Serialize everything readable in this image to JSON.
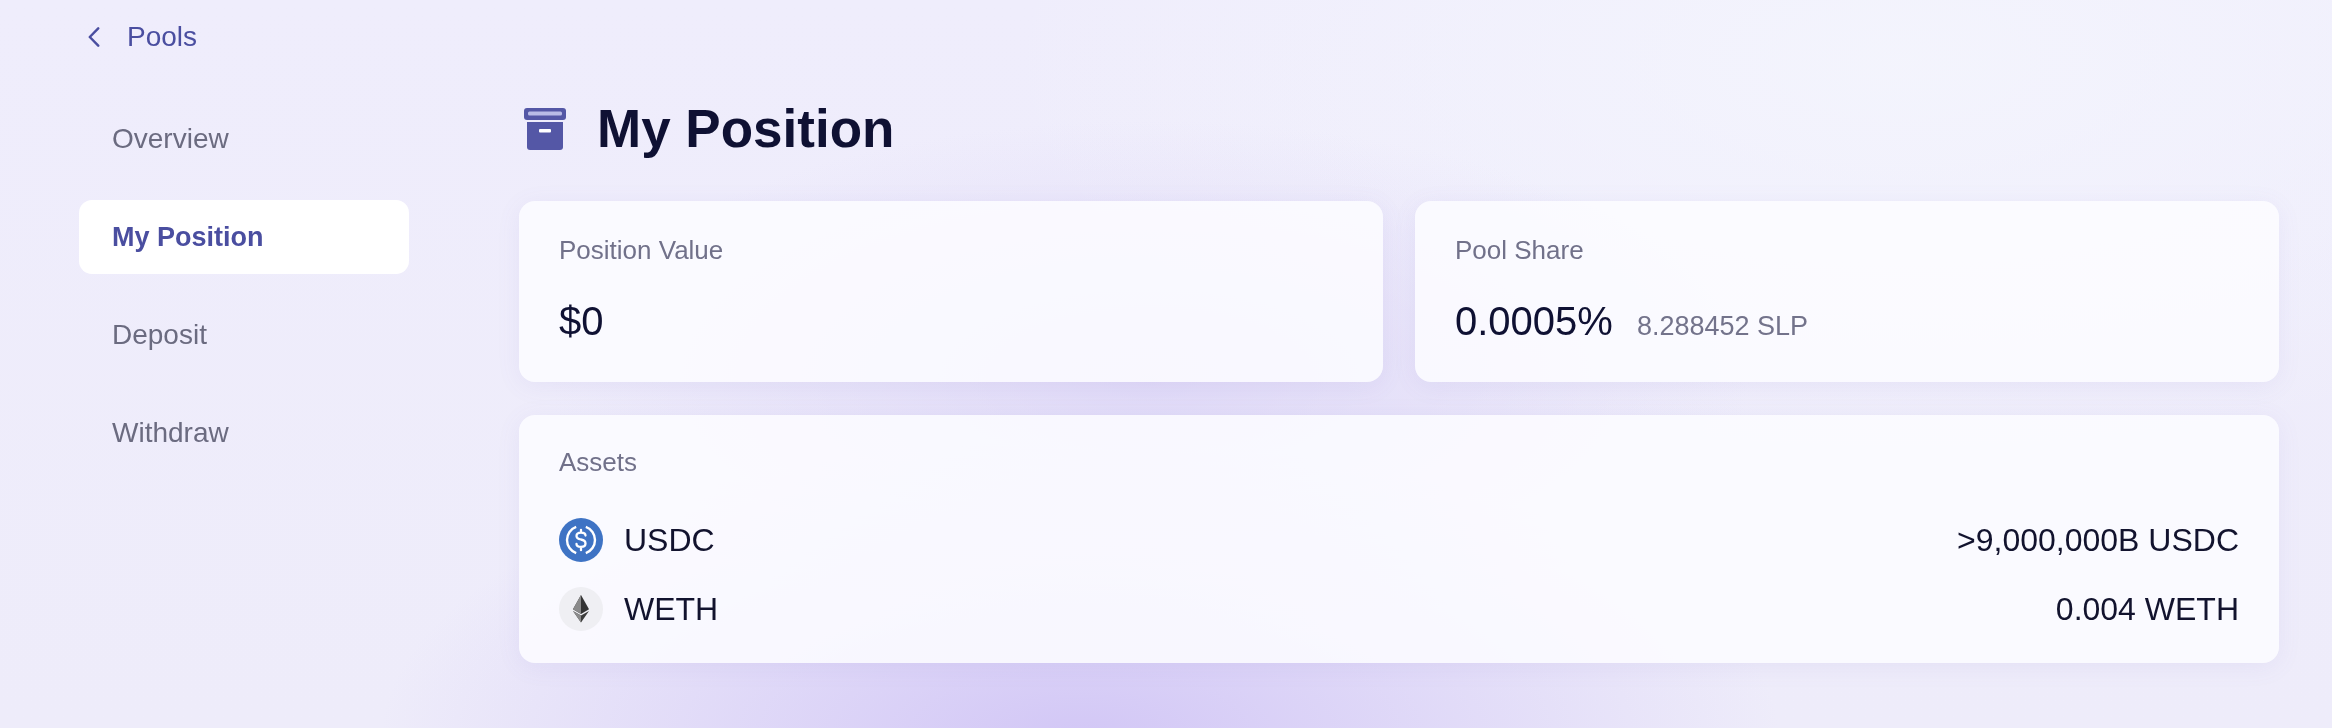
{
  "back_link": {
    "label": "Pools"
  },
  "sidebar": {
    "items": [
      {
        "label": "Overview",
        "selected": false
      },
      {
        "label": "My Position",
        "selected": true
      },
      {
        "label": "Deposit",
        "selected": false
      },
      {
        "label": "Withdraw",
        "selected": false
      }
    ]
  },
  "page_title": "My Position",
  "stats": [
    {
      "label": "Position Value",
      "value": "$0"
    },
    {
      "label": "Pool Share",
      "value": "0.0005%",
      "secondary": "8.288452 SLP"
    }
  ],
  "assets": {
    "title": "Assets",
    "rows": [
      {
        "kind": "usd",
        "symbol": "USDC",
        "amount": ">9,000,000B USDC"
      },
      {
        "kind": "eth",
        "symbol": "WETH",
        "amount": "0.004 WETH"
      }
    ]
  }
}
